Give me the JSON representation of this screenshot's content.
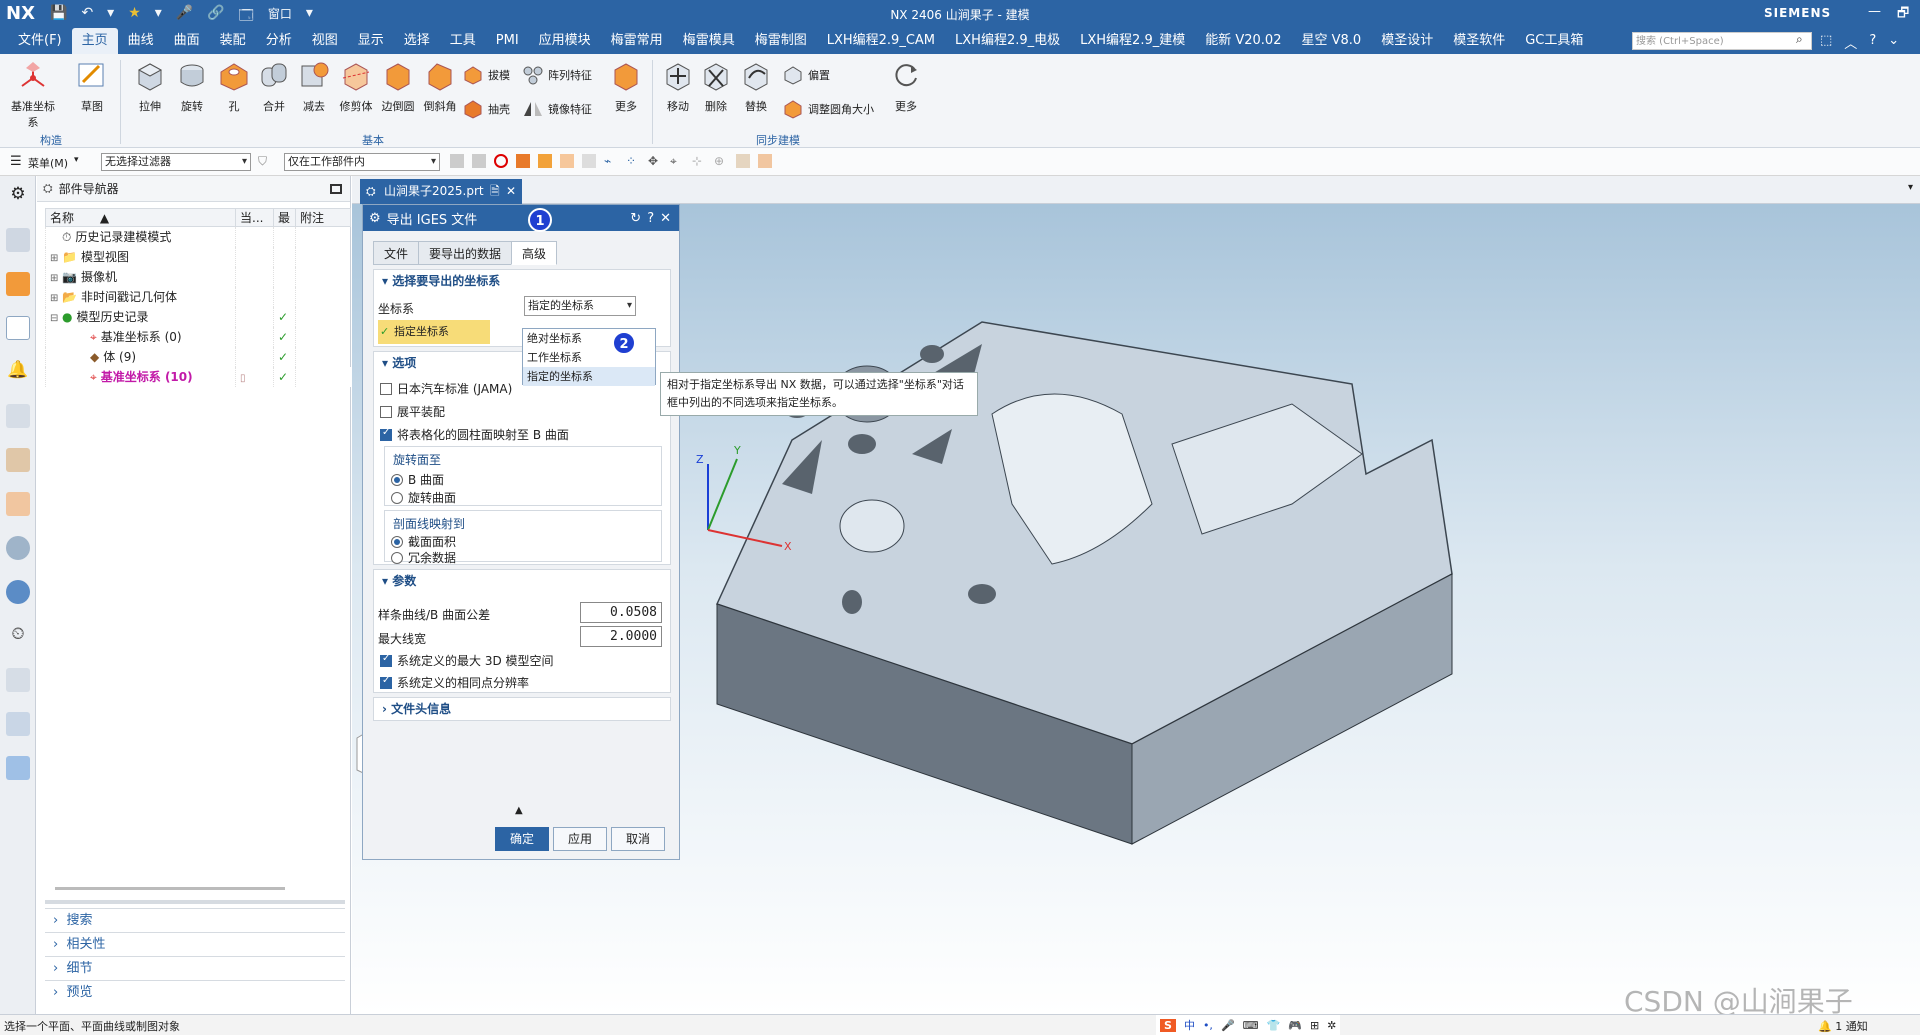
{
  "titlebar": {
    "logo": "NX",
    "title": "NX 2406 山涧果子 - 建模",
    "brand": "SIEMENS",
    "win": [
      "—",
      "🗗",
      "✕"
    ],
    "quick": [
      "💾",
      "↶",
      "▾",
      "★",
      "▾",
      "🎤",
      "🔗",
      "🗔",
      "窗口",
      "▾"
    ]
  },
  "menubar": {
    "items": [
      "文件(F)",
      "主页",
      "曲线",
      "曲面",
      "装配",
      "分析",
      "视图",
      "显示",
      "选择",
      "工具",
      "PMI",
      "应用模块",
      "梅雷常用",
      "梅雷模具",
      "梅雷制图",
      "LXH编程2.9_CAM",
      "LXH编程2.9_电极",
      "LXH编程2.9_建模",
      "能新 V20.02",
      "星空 V8.0",
      "模圣设计",
      "模圣软件",
      "GC工具箱"
    ],
    "active_index": 1,
    "search_placeholder": "搜索 (Ctrl+Space)",
    "right_icons": [
      "⬚",
      "︿",
      "?",
      "⌄"
    ]
  },
  "ribbon": {
    "big": [
      "基准坐标系",
      "草图",
      "拉伸",
      "旋转",
      "孔",
      "合并",
      "减去",
      "修剪体",
      "边倒圆",
      "倒斜角",
      "更多",
      "移动",
      "删除",
      "替换",
      "更多"
    ],
    "small": [
      "拔模",
      "阵列特征",
      "抽壳",
      "镜像特征",
      "偏置",
      "调整圆角大小"
    ],
    "groups": [
      "构造",
      "基本",
      "同步建模"
    ]
  },
  "toolbar2": {
    "menu": "菜单(M)",
    "filter": "无选择过滤器",
    "scope": "仅在工作部件内"
  },
  "navigator": {
    "title": "部件导航器",
    "columns": [
      "名称",
      "当...",
      "最",
      "附注"
    ],
    "rows": [
      {
        "label": "历史记录建模模式",
        "indent": 0
      },
      {
        "label": "模型视图",
        "indent": 0
      },
      {
        "label": "摄像机",
        "indent": 0
      },
      {
        "label": "非时间戳记几何体",
        "indent": 0
      },
      {
        "label": "模型历史记录",
        "indent": 0
      },
      {
        "label": "基准坐标系 (0)",
        "indent": 1
      },
      {
        "label": "体 (9)",
        "indent": 1
      },
      {
        "label": "基准坐标系 (10)",
        "indent": 1
      }
    ],
    "bottom": [
      "搜索",
      "相关性",
      "细节",
      "预览"
    ]
  },
  "tab": {
    "label": "山涧果子2025.prt"
  },
  "dialog": {
    "title": "导出 IGES 文件",
    "tabs": [
      "文件",
      "要导出的数据",
      "高级"
    ],
    "sec_cs": "选择要导出的坐标系",
    "cs_label": "坐标系",
    "cs_value": "指定的坐标系",
    "cs_specify": "指定坐标系",
    "dropdown_options": [
      "绝对坐标系",
      "工作坐标系",
      "指定的坐标系"
    ],
    "tooltip": "相对于指定坐标系导出 NX 数据，可以通过选择\"坐标系\"对话框中列出的不同选项来指定坐标系。",
    "sec_opts": "选项",
    "opt_jama": "日本汽车标准 (JAMA)",
    "opt_flatten": "展平装配",
    "opt_map": "将表格化的圆柱面映射至 B 曲面",
    "rot_title": "旋转面至",
    "rot_b": "B 曲面",
    "rot_rev": "旋转曲面",
    "sect_title": "剖面线映射到",
    "sect_area": "截面面积",
    "sect_redundant": "冗余数据",
    "sec_params": "参数",
    "tol_label": "样条曲线/B 曲面公差",
    "tol_value": "0.0508",
    "lw_label": "最大线宽",
    "lw_value": "2.0000",
    "sys_3d": "系统定义的最大 3D 模型空间",
    "sys_res": "系统定义的相同点分辨率",
    "sec_header": "文件头信息",
    "ok": "确定",
    "apply": "应用",
    "cancel": "取消"
  },
  "badges": [
    "1",
    "2"
  ],
  "triad": {
    "x": "X",
    "y": "Y",
    "z": "Z"
  },
  "status": {
    "text": "选择一个平面、平面曲线或制图对象",
    "notice": "1 通知",
    "ime": [
      "中",
      "•,",
      "🎤",
      "⌨",
      "👕",
      "🎮",
      "⊞",
      "✲"
    ]
  },
  "watermark": "CSDN @山涧果子"
}
